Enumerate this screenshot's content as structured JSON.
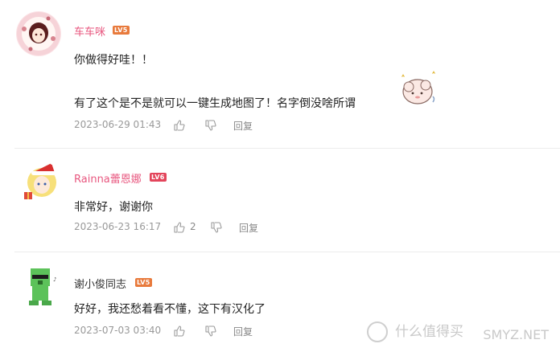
{
  "colors": {
    "username_pink": "#e8577f",
    "username_dark": "#333333",
    "level_orange": "#e87a3c",
    "level_red": "#e3455b",
    "meta_gray": "#999999"
  },
  "comments": [
    {
      "username": "车车咪",
      "level": "LV5",
      "lines": [
        "你做得好哇！！",
        "有了这个是不是就可以一键生成地图了！名字倒没啥所谓"
      ],
      "time": "2023-06-29 01:43",
      "likes": "",
      "reply_label": "回复"
    },
    {
      "username": "Rainna蕾恩娜",
      "level": "LV6",
      "lines": [
        "非常好，谢谢你"
      ],
      "time": "2023-06-23 16:17",
      "likes": "2",
      "reply_label": "回复"
    },
    {
      "username": "谢小俊同志",
      "level": "LV5",
      "lines": [
        "好好，我还愁着看不懂，这下有汉化了"
      ],
      "time": "2023-07-03 03:40",
      "likes": "",
      "reply_label": "回复"
    }
  ],
  "watermark": "什么值得买",
  "watermark_domain": "SMYZ.NET"
}
